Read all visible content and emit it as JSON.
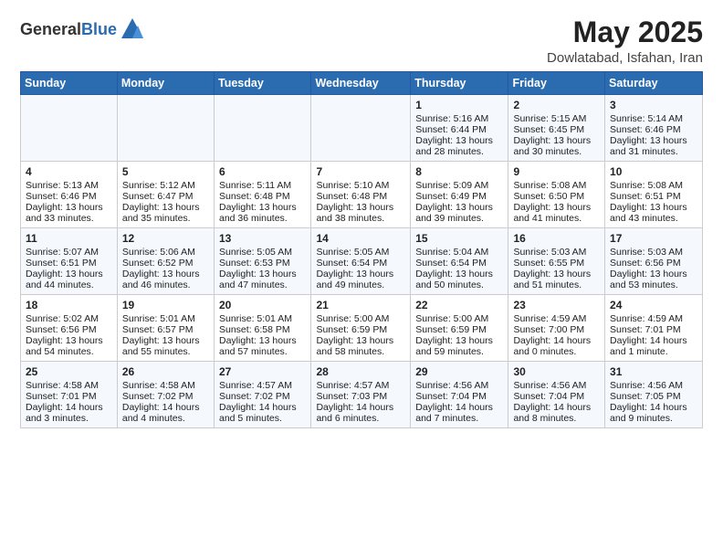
{
  "logo": {
    "general": "General",
    "blue": "Blue"
  },
  "header": {
    "month_year": "May 2025",
    "location": "Dowlatabad, Isfahan, Iran"
  },
  "days_of_week": [
    "Sunday",
    "Monday",
    "Tuesday",
    "Wednesday",
    "Thursday",
    "Friday",
    "Saturday"
  ],
  "weeks": [
    [
      {
        "day": "",
        "sunrise": "",
        "sunset": "",
        "daylight": ""
      },
      {
        "day": "",
        "sunrise": "",
        "sunset": "",
        "daylight": ""
      },
      {
        "day": "",
        "sunrise": "",
        "sunset": "",
        "daylight": ""
      },
      {
        "day": "",
        "sunrise": "",
        "sunset": "",
        "daylight": ""
      },
      {
        "day": "1",
        "sunrise": "Sunrise: 5:16 AM",
        "sunset": "Sunset: 6:44 PM",
        "daylight": "Daylight: 13 hours and 28 minutes."
      },
      {
        "day": "2",
        "sunrise": "Sunrise: 5:15 AM",
        "sunset": "Sunset: 6:45 PM",
        "daylight": "Daylight: 13 hours and 30 minutes."
      },
      {
        "day": "3",
        "sunrise": "Sunrise: 5:14 AM",
        "sunset": "Sunset: 6:46 PM",
        "daylight": "Daylight: 13 hours and 31 minutes."
      }
    ],
    [
      {
        "day": "4",
        "sunrise": "Sunrise: 5:13 AM",
        "sunset": "Sunset: 6:46 PM",
        "daylight": "Daylight: 13 hours and 33 minutes."
      },
      {
        "day": "5",
        "sunrise": "Sunrise: 5:12 AM",
        "sunset": "Sunset: 6:47 PM",
        "daylight": "Daylight: 13 hours and 35 minutes."
      },
      {
        "day": "6",
        "sunrise": "Sunrise: 5:11 AM",
        "sunset": "Sunset: 6:48 PM",
        "daylight": "Daylight: 13 hours and 36 minutes."
      },
      {
        "day": "7",
        "sunrise": "Sunrise: 5:10 AM",
        "sunset": "Sunset: 6:48 PM",
        "daylight": "Daylight: 13 hours and 38 minutes."
      },
      {
        "day": "8",
        "sunrise": "Sunrise: 5:09 AM",
        "sunset": "Sunset: 6:49 PM",
        "daylight": "Daylight: 13 hours and 39 minutes."
      },
      {
        "day": "9",
        "sunrise": "Sunrise: 5:08 AM",
        "sunset": "Sunset: 6:50 PM",
        "daylight": "Daylight: 13 hours and 41 minutes."
      },
      {
        "day": "10",
        "sunrise": "Sunrise: 5:08 AM",
        "sunset": "Sunset: 6:51 PM",
        "daylight": "Daylight: 13 hours and 43 minutes."
      }
    ],
    [
      {
        "day": "11",
        "sunrise": "Sunrise: 5:07 AM",
        "sunset": "Sunset: 6:51 PM",
        "daylight": "Daylight: 13 hours and 44 minutes."
      },
      {
        "day": "12",
        "sunrise": "Sunrise: 5:06 AM",
        "sunset": "Sunset: 6:52 PM",
        "daylight": "Daylight: 13 hours and 46 minutes."
      },
      {
        "day": "13",
        "sunrise": "Sunrise: 5:05 AM",
        "sunset": "Sunset: 6:53 PM",
        "daylight": "Daylight: 13 hours and 47 minutes."
      },
      {
        "day": "14",
        "sunrise": "Sunrise: 5:05 AM",
        "sunset": "Sunset: 6:54 PM",
        "daylight": "Daylight: 13 hours and 49 minutes."
      },
      {
        "day": "15",
        "sunrise": "Sunrise: 5:04 AM",
        "sunset": "Sunset: 6:54 PM",
        "daylight": "Daylight: 13 hours and 50 minutes."
      },
      {
        "day": "16",
        "sunrise": "Sunrise: 5:03 AM",
        "sunset": "Sunset: 6:55 PM",
        "daylight": "Daylight: 13 hours and 51 minutes."
      },
      {
        "day": "17",
        "sunrise": "Sunrise: 5:03 AM",
        "sunset": "Sunset: 6:56 PM",
        "daylight": "Daylight: 13 hours and 53 minutes."
      }
    ],
    [
      {
        "day": "18",
        "sunrise": "Sunrise: 5:02 AM",
        "sunset": "Sunset: 6:56 PM",
        "daylight": "Daylight: 13 hours and 54 minutes."
      },
      {
        "day": "19",
        "sunrise": "Sunrise: 5:01 AM",
        "sunset": "Sunset: 6:57 PM",
        "daylight": "Daylight: 13 hours and 55 minutes."
      },
      {
        "day": "20",
        "sunrise": "Sunrise: 5:01 AM",
        "sunset": "Sunset: 6:58 PM",
        "daylight": "Daylight: 13 hours and 57 minutes."
      },
      {
        "day": "21",
        "sunrise": "Sunrise: 5:00 AM",
        "sunset": "Sunset: 6:59 PM",
        "daylight": "Daylight: 13 hours and 58 minutes."
      },
      {
        "day": "22",
        "sunrise": "Sunrise: 5:00 AM",
        "sunset": "Sunset: 6:59 PM",
        "daylight": "Daylight: 13 hours and 59 minutes."
      },
      {
        "day": "23",
        "sunrise": "Sunrise: 4:59 AM",
        "sunset": "Sunset: 7:00 PM",
        "daylight": "Daylight: 14 hours and 0 minutes."
      },
      {
        "day": "24",
        "sunrise": "Sunrise: 4:59 AM",
        "sunset": "Sunset: 7:01 PM",
        "daylight": "Daylight: 14 hours and 1 minute."
      }
    ],
    [
      {
        "day": "25",
        "sunrise": "Sunrise: 4:58 AM",
        "sunset": "Sunset: 7:01 PM",
        "daylight": "Daylight: 14 hours and 3 minutes."
      },
      {
        "day": "26",
        "sunrise": "Sunrise: 4:58 AM",
        "sunset": "Sunset: 7:02 PM",
        "daylight": "Daylight: 14 hours and 4 minutes."
      },
      {
        "day": "27",
        "sunrise": "Sunrise: 4:57 AM",
        "sunset": "Sunset: 7:02 PM",
        "daylight": "Daylight: 14 hours and 5 minutes."
      },
      {
        "day": "28",
        "sunrise": "Sunrise: 4:57 AM",
        "sunset": "Sunset: 7:03 PM",
        "daylight": "Daylight: 14 hours and 6 minutes."
      },
      {
        "day": "29",
        "sunrise": "Sunrise: 4:56 AM",
        "sunset": "Sunset: 7:04 PM",
        "daylight": "Daylight: 14 hours and 7 minutes."
      },
      {
        "day": "30",
        "sunrise": "Sunrise: 4:56 AM",
        "sunset": "Sunset: 7:04 PM",
        "daylight": "Daylight: 14 hours and 8 minutes."
      },
      {
        "day": "31",
        "sunrise": "Sunrise: 4:56 AM",
        "sunset": "Sunset: 7:05 PM",
        "daylight": "Daylight: 14 hours and 9 minutes."
      }
    ]
  ]
}
